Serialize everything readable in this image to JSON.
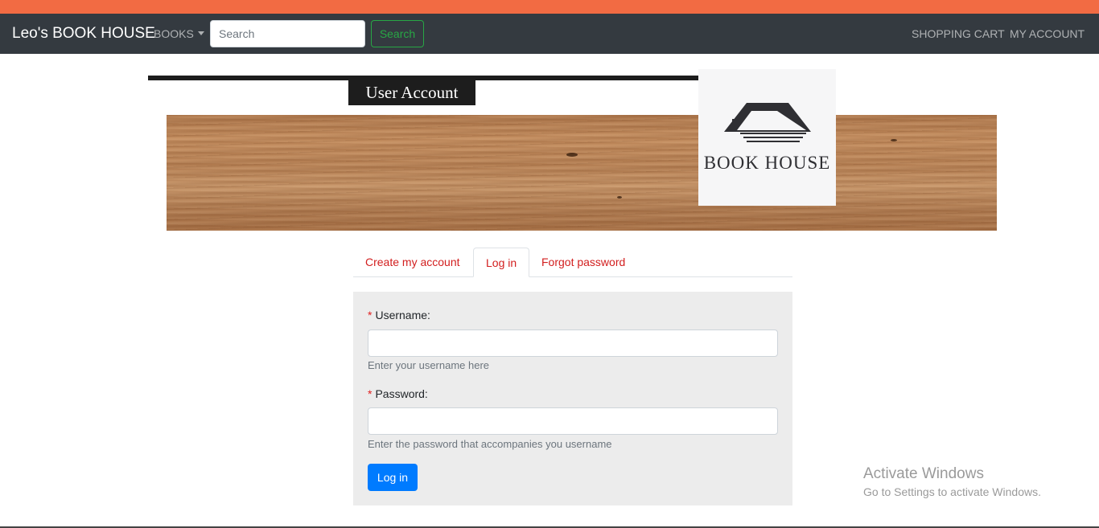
{
  "navbar": {
    "brand": "Leo's BOOK HOUSE",
    "books_label": "BOOKS",
    "search_placeholder": "Search",
    "search_button": "Search",
    "cart_label": "SHOPPING CART",
    "account_label": "MY ACCOUNT"
  },
  "header": {
    "title": "User Account",
    "logo_text": "BOOK HOUSE"
  },
  "tabs": [
    {
      "label": "Create my account",
      "active": false
    },
    {
      "label": "Log in",
      "active": true
    },
    {
      "label": "Forgot password",
      "active": false
    }
  ],
  "form": {
    "required_mark": "*",
    "username_label": "Username:",
    "username_value": "",
    "username_help": "Enter your username here",
    "password_label": "Password:",
    "password_value": "",
    "password_help": "Enter the password that accompanies you username",
    "submit_label": "Log in"
  },
  "watermark": {
    "title": "Activate Windows",
    "subtitle": "Go to Settings to activate Windows."
  },
  "colors": {
    "accent_strip": "#f26b43",
    "navbar": "#343a40",
    "tab_link": "#d21e1e",
    "primary_button": "#007bff",
    "search_button": "#28a745"
  }
}
